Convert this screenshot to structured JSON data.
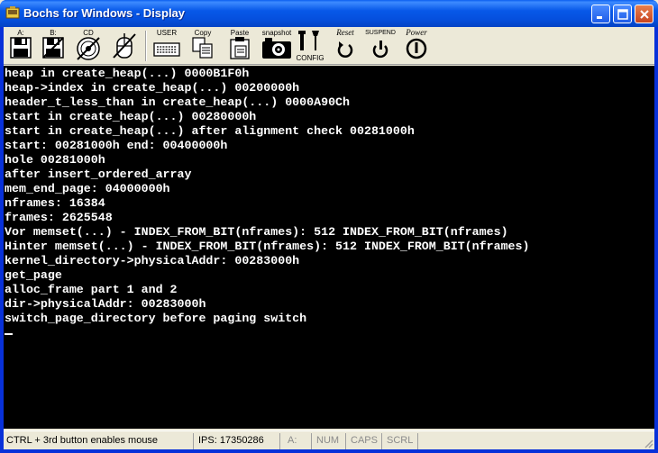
{
  "window": {
    "title": "Bochs for Windows - Display",
    "controls": {
      "minimize": "minimize",
      "maximize": "maximize",
      "close": "close"
    }
  },
  "toolbar": {
    "floppy_a": "A:",
    "floppy_b": "B:",
    "cdrom": "CD",
    "mouse": "",
    "user": "USER",
    "copy": "Copy",
    "paste": "Paste",
    "snapshot": "snapshot",
    "config": "CONFIG",
    "reset": "Reset",
    "suspend": "SUSPEND",
    "power": "Power"
  },
  "console": {
    "lines": [
      "heap in create_heap(...) 0000B1F0h",
      "heap->index in create_heap(...) 00200000h",
      "header_t_less_than in create_heap(...) 0000A90Ch",
      "start in create_heap(...) 00280000h",
      "start in create_heap(...) after alignment check 00281000h",
      "start: 00281000h end: 00400000h",
      "hole 00281000h",
      "after insert_ordered_array",
      "mem_end_page: 04000000h",
      "nframes: 16384",
      "frames: 2625548",
      "Vor memset(...) - INDEX_FROM_BIT(nframes): 512 INDEX_FROM_BIT(nframes)",
      "Hinter memset(...) - INDEX_FROM_BIT(nframes): 512 INDEX_FROM_BIT(nframes)",
      "kernel_directory->physicalAddr: 00283000h",
      "get_page",
      "alloc_frame part 1 and 2",
      "dir->physicalAddr: 00283000h",
      "switch_page_directory before paging switch"
    ]
  },
  "statusbar": {
    "hint": "CTRL + 3rd button enables mouse",
    "ips": "IPS: 17350286",
    "drive": "A:",
    "num": "NUM",
    "caps": "CAPS",
    "scrl": "SCRL"
  },
  "colors": {
    "titlebar": "#0758E8",
    "console_bg": "#000000",
    "console_fg": "#FFFFFF",
    "chrome": "#ECE9D8"
  }
}
